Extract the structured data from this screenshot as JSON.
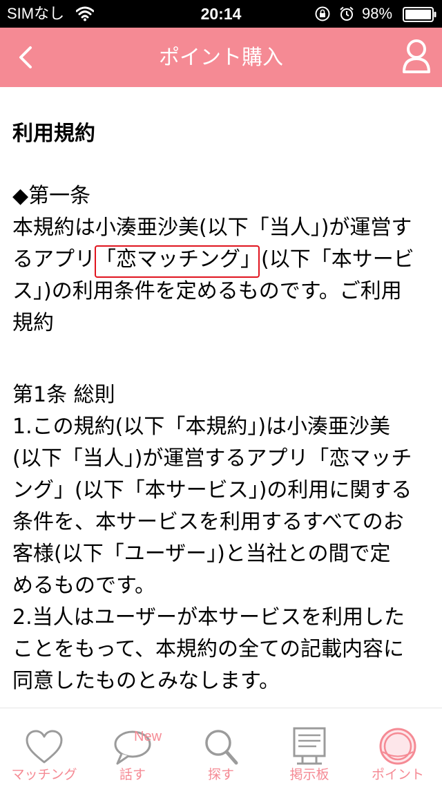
{
  "status_bar": {
    "carrier": "SIMなし",
    "time": "20:14",
    "battery": "98%"
  },
  "nav": {
    "title": "ポイント購入",
    "back_icon": "chevron-left-icon",
    "profile_icon": "user-icon"
  },
  "content": {
    "heading": "利用規約",
    "lines": [
      "◆第一条",
      "本規約は小湊亜沙美(以下「当人」)が運営す",
      "るアプリ「恋マッチング」(以下「本サービ",
      "ス」)の利用条件を定めるものです。ご利用",
      "規約",
      "第1条 総則",
      "1.この規約(以下「本規約」)は小湊亜沙美",
      "(以下「当人」)が運営するアプリ「恋マッチ",
      "ング」(以下「本サービス」)の利用に関する",
      "条件を、本サービスを利用するすべてのお",
      "客様(以下「ユーザー」)と当社との間で定",
      "めるものです。",
      "2.当人はユーザーが本サービスを利用した",
      "ことをもって、本規約の全ての記載内容に",
      "同意したものとみなします。"
    ]
  },
  "tabs": [
    {
      "label": "マッチング",
      "icon": "heart-icon"
    },
    {
      "label": "話す",
      "icon": "speech-bubble-icon",
      "badge": "New"
    },
    {
      "label": "探す",
      "icon": "search-icon"
    },
    {
      "label": "掲示板",
      "icon": "bulletin-board-icon"
    },
    {
      "label": "ポイント",
      "icon": "coin-icon"
    }
  ],
  "colors": {
    "accent": "#f58a94",
    "highlight_border": "#e0141e",
    "tab_icon_gray": "#9b9b9b"
  }
}
